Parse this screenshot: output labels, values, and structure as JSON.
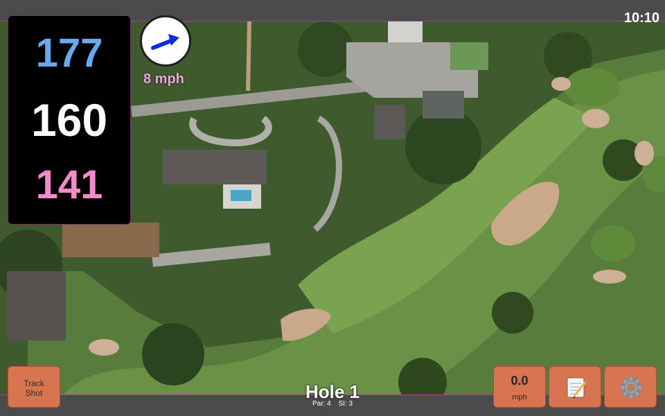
{
  "status": {
    "time": "10:10"
  },
  "distances": {
    "back": "177",
    "middle": "160",
    "front": "141"
  },
  "wind": {
    "speed_text": "8 mph",
    "arrow_icon": "arrow-right-up-icon"
  },
  "hole": {
    "title": "Hole 1",
    "par": "Par: 4",
    "si": "SI: 3"
  },
  "buttons": {
    "track_shot": [
      "Track",
      "Shot"
    ],
    "speed_value": "0.0",
    "speed_unit": "mph",
    "notes_icon": "notepad-icon",
    "settings_icon": "gear-icon"
  },
  "colors": {
    "back": "#66aaf0",
    "middle": "#ffffff",
    "front": "#f48ac8",
    "button": "#d87450",
    "accent": "#b03a9a"
  }
}
